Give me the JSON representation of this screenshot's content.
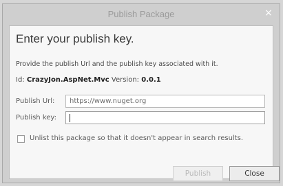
{
  "window": {
    "title": "Publish Package",
    "close_glyph": "×"
  },
  "dialog": {
    "heading": "Enter your publish key.",
    "description": "Provide the publish Url and the publish key associated with it.",
    "id_label": "Id:",
    "id_value": "CrazyJon.AspNet.Mvc",
    "version_label": "Version:",
    "version_value": "0.0.1",
    "publish_url_label": "Publish Url:",
    "publish_url_value": "https://www.nuget.org",
    "publish_key_label": "Publish key:",
    "publish_key_value": "",
    "unlist_checked": false,
    "unlist_label": "Unlist this package so that it doesn't appear in search results."
  },
  "buttons": {
    "publish_label": "Publish",
    "close_label": "Close"
  },
  "colors": {
    "frame": "#cfcfcf",
    "content_bg": "#f7f7f7",
    "disabled_text": "#b9b9b9"
  }
}
